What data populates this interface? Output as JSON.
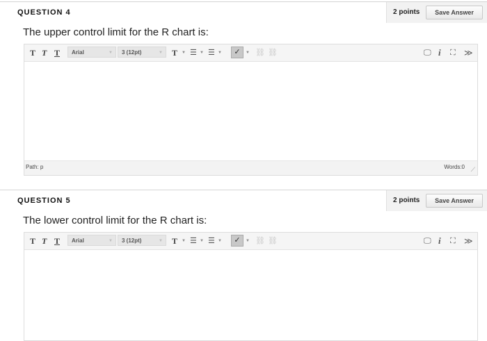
{
  "questions": [
    {
      "title": "QUESTION 4",
      "points": "2 points",
      "save_label": "Save Answer",
      "text": "The upper control limit for the R chart is:",
      "path_label": "Path: p",
      "words_label": "Words:0"
    },
    {
      "title": "QUESTION 5",
      "points": "2 points",
      "save_label": "Save Answer",
      "text": "The lower control limit for the R chart is:"
    }
  ],
  "toolbar": {
    "bold_glyph": "T",
    "italic_glyph": "T",
    "underline_glyph": "T",
    "font_family": "Arial",
    "font_size": "3 (12pt)",
    "text_color_glyph": "T",
    "bullet_list_glyph": "☰",
    "numbered_list_glyph": "☰",
    "spellcheck_glyph": "✓",
    "link_glyph": "⛓",
    "unlink_glyph": "⛓",
    "preview_glyph": "🖵",
    "info_glyph": "i",
    "fullscreen_glyph": "⛶",
    "collapse_glyph": "≫"
  },
  "icons": {
    "bold": "bold-icon",
    "italic": "italic-icon",
    "underline": "underline-icon",
    "text_color": "text-color-icon",
    "bullet_list": "bullet-list-icon",
    "numbered_list": "numbered-list-icon",
    "spellcheck": "spellcheck-icon",
    "link": "link-icon",
    "unlink": "unlink-icon",
    "preview": "preview-icon",
    "info": "info-icon",
    "fullscreen": "fullscreen-icon",
    "collapse": "collapse-toolbar-icon"
  }
}
